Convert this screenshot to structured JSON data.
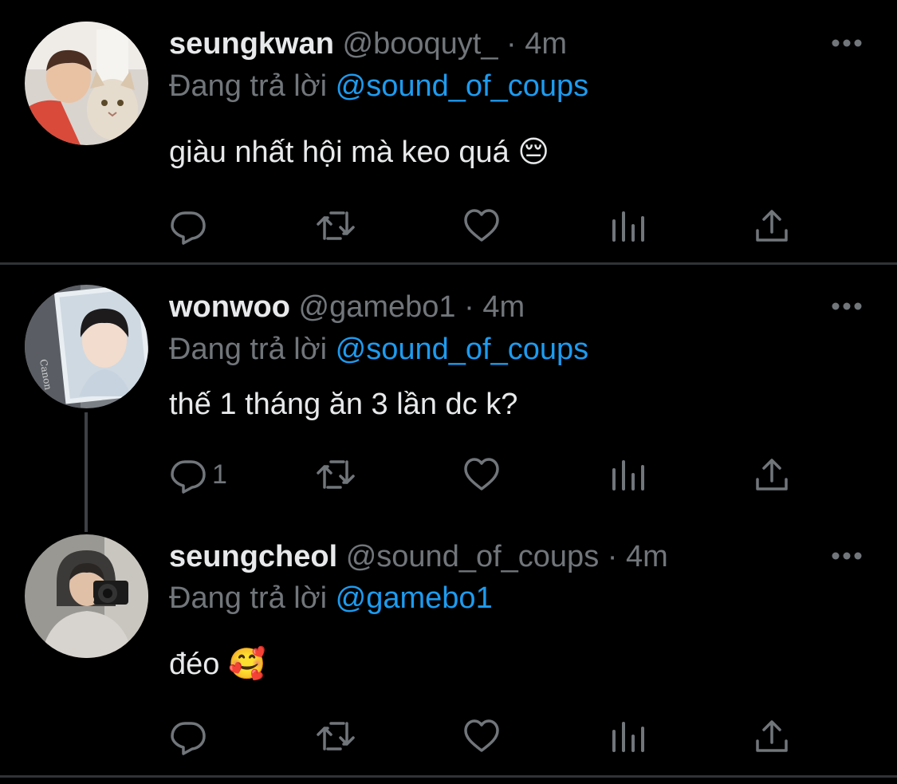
{
  "tweets": [
    {
      "name": "seungkwan",
      "handle": "@booquyt_",
      "dot": "·",
      "time": "4m",
      "reply_prefix": "Đang trả lời",
      "reply_to": "@sound_of_coups",
      "text": "giàu nhất hội mà keo quá 😔",
      "reply_count": ""
    },
    {
      "name": "wonwoo",
      "handle": "@gamebo1",
      "dot": "·",
      "time": "4m",
      "reply_prefix": "Đang trả lời",
      "reply_to": "@sound_of_coups",
      "text": "thế 1 tháng ăn 3 lần dc k?",
      "reply_count": "1"
    },
    {
      "name": "seungcheol",
      "handle": "@sound_of_coups",
      "dot": "·",
      "time": "4m",
      "reply_prefix": "Đang trả lời",
      "reply_to": "@gamebo1",
      "text": "đéo 🥰",
      "reply_count": ""
    }
  ],
  "icons": {
    "reply": "reply-icon",
    "retweet": "retweet-icon",
    "like": "heart-icon",
    "views": "analytics-icon",
    "share": "share-icon",
    "more": "more-icon"
  },
  "colors": {
    "background": "#000000",
    "text": "#e7e9ea",
    "muted": "#71767b",
    "link": "#1d9bf0",
    "separator": "#2f3336"
  }
}
